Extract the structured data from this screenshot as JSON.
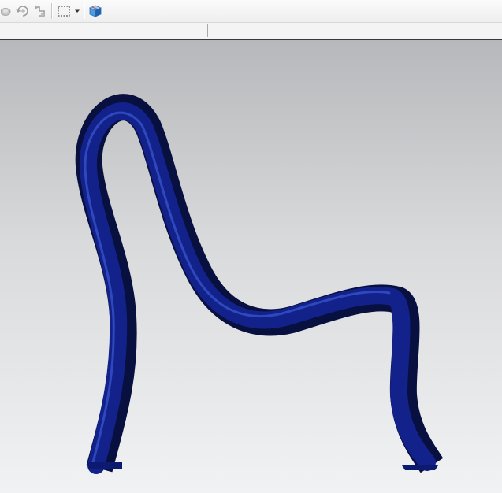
{
  "toolbar": {
    "buttons": [
      {
        "name": "shaded-view-icon",
        "enabled": false
      },
      {
        "name": "rotate-view-icon",
        "enabled": false
      },
      {
        "name": "pan-view-icon",
        "enabled": false
      },
      {
        "name": "selection-box-icon",
        "enabled": true
      },
      {
        "name": "dropdown-arrow-icon",
        "enabled": true
      },
      {
        "name": "3d-view-cube-icon",
        "enabled": true
      }
    ]
  },
  "statusbar": {
    "left_text": "",
    "right_text": ""
  },
  "model": {
    "object": "chair-tube-model",
    "color": "#0f1f86",
    "shadow_color": "#0a124f",
    "highlight_color": "#3b53c9"
  },
  "colors": {
    "viewport_top": "#b7b8bb",
    "viewport_bottom": "#f1f2f3",
    "statusbar_border": "#3a3a3a"
  }
}
